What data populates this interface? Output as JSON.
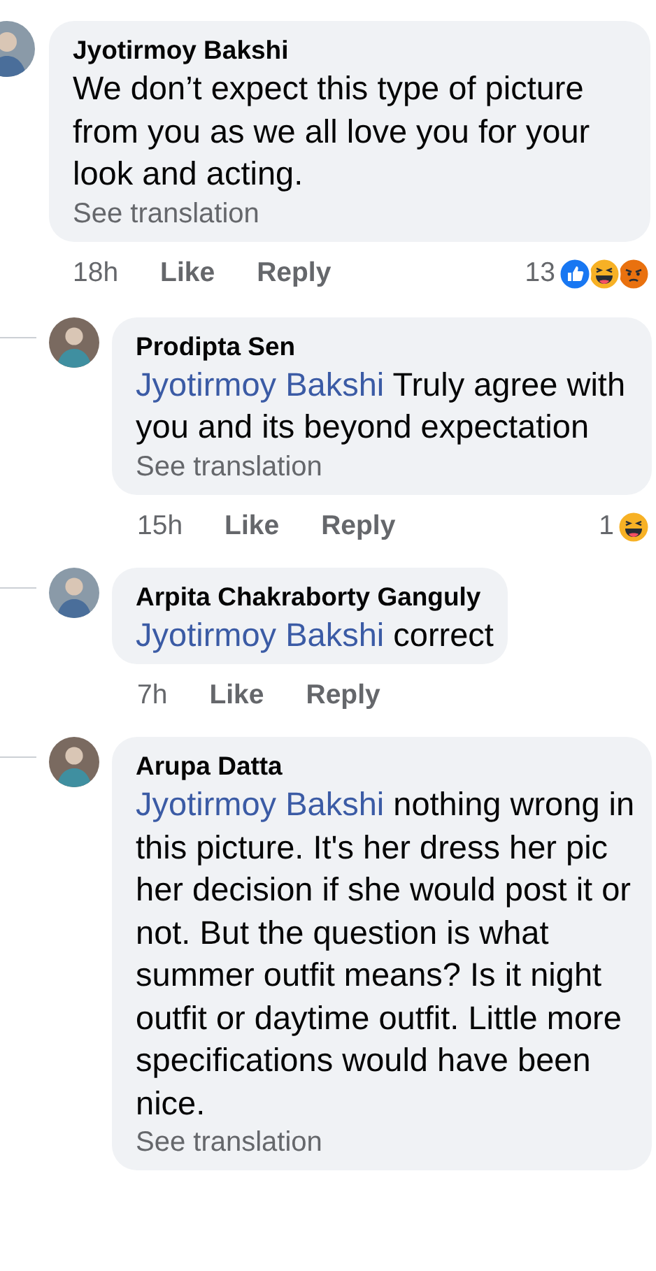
{
  "comments": [
    {
      "kind": "top",
      "author": "Jyotirmoy Bakshi",
      "text": "We don’t expect this type of picture from you as we all love you for your look and acting.",
      "see_translation": "See translation",
      "time": "18h",
      "like": "Like",
      "reply": "Reply",
      "reactions": {
        "count": "13",
        "types": [
          {
            "kind": "like"
          },
          {
            "kind": "haha"
          },
          {
            "kind": "angry"
          }
        ]
      }
    },
    {
      "kind": "reply",
      "author": "Prodipta Sen",
      "mention": "Jyotirmoy Bakshi",
      "text": "Truly agree with you and its beyond expectation",
      "see_translation": "See translation",
      "time": "15h",
      "like": "Like",
      "reply": "Reply",
      "reactions": {
        "count": "1",
        "types": [
          {
            "kind": "haha"
          }
        ]
      }
    },
    {
      "kind": "reply",
      "author": "Arpita Chakraborty Ganguly",
      "mention": "Jyotirmoy Bakshi",
      "text": "correct",
      "time": "7h",
      "like": "Like",
      "reply": "Reply"
    },
    {
      "kind": "reply",
      "author": "Arupa Datta",
      "mention": "Jyotirmoy Bakshi",
      "text": "nothing wrong in this picture. It's her dress her pic her decision if she would post it or not. But the question is what summer outfit means? Is it night outfit or daytime outfit. Little more specifications would have been nice.",
      "see_translation": "See translation"
    }
  ]
}
